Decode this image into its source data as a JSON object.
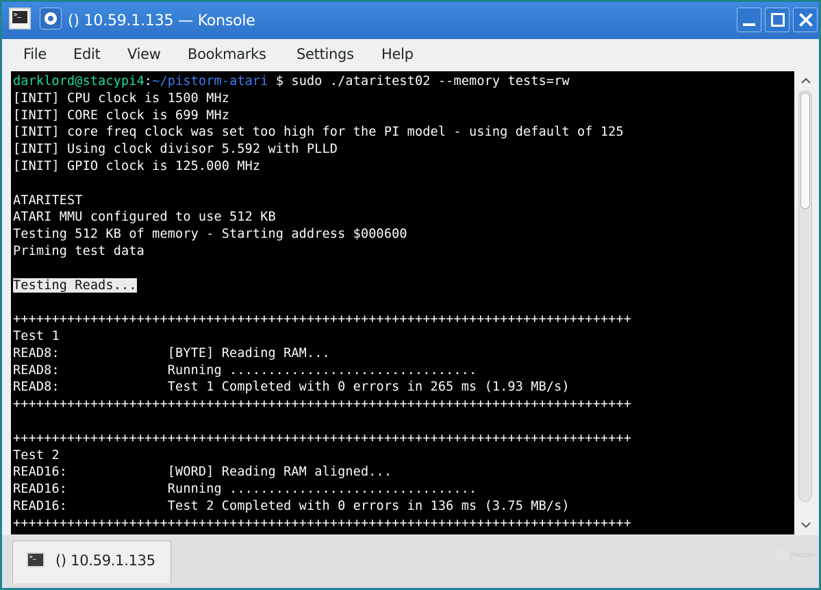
{
  "window": {
    "title": "() 10.59.1.135 — Konsole",
    "app_icon_glyph": ">_",
    "accent_color": "#3d85dd"
  },
  "menubar": {
    "items": [
      "File",
      "Edit",
      "View",
      "Bookmarks",
      "Settings",
      "Help"
    ]
  },
  "terminal": {
    "prompt_user": "darklord@stacypi4",
    "prompt_sep": ":",
    "prompt_path": "~/pistorm-atari",
    "prompt_symbol": " $ ",
    "command": "sudo ./ataritest02 --memory tests=rw",
    "output_lines": [
      "[INIT] CPU clock is 1500 MHz",
      "[INIT] CORE clock is 699 MHz",
      "[INIT] core freq clock was set too high for the PI model - using default of 125",
      "[INIT] Using clock divisor 5.592 with PLLD",
      "[INIT] GPIO clock is 125.000 MHz",
      "",
      "ATARITEST",
      "ATARI MMU configured to use 512 KB",
      "Testing 512 KB of memory - Starting address $000600",
      "Priming test data",
      "",
      "Testing Reads...",
      "",
      "++++++++++++++++++++++++++++++++++++++++++++++++++++++++++++++++++++++++++++++++",
      "Test 1",
      "READ8:              [BYTE] Reading RAM...",
      "READ8:              Running ................................",
      "READ8:              Test 1 Completed with 0 errors in 265 ms (1.93 MB/s)",
      "++++++++++++++++++++++++++++++++++++++++++++++++++++++++++++++++++++++++++++++++",
      "",
      "++++++++++++++++++++++++++++++++++++++++++++++++++++++++++++++++++++++++++++++++",
      "Test 2",
      "READ16:             [WORD] Reading RAM aligned...",
      "READ16:             Running ................................",
      "READ16:             Test 2 Completed with 0 errors in 136 ms (3.75 MB/s)",
      "++++++++++++++++++++++++++++++++++++++++++++++++++++++++++++++++++++++++++++++++"
    ],
    "highlighted_line_index": 11,
    "colors": {
      "background": "#000000",
      "foreground": "#fcfcfc",
      "prompt_user": "#1cdc9a",
      "prompt_path": "#3d7ef5"
    }
  },
  "tabs": [
    {
      "label": "() 10.59.1.135",
      "icon": "terminal-icon",
      "active": true
    }
  ],
  "tabbar": {
    "ghost_text": "Rectan"
  }
}
